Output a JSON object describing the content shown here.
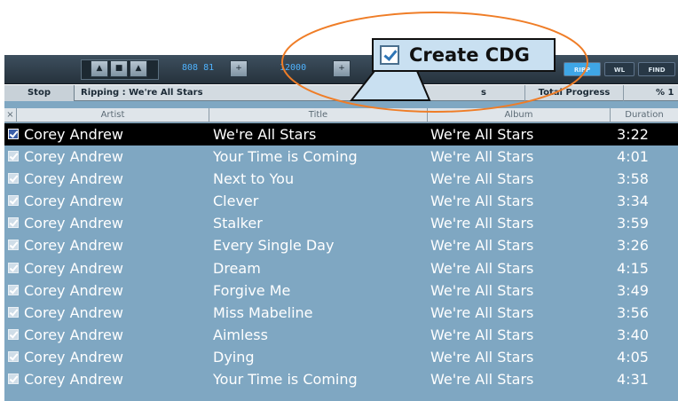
{
  "toolbar": {
    "lcd_left": "808 81",
    "lcd_right": "12000",
    "rip_button": "RIPP",
    "wl_button": "WL",
    "find_button": "FIND"
  },
  "status": {
    "stop_button": "Stop",
    "ripping_text": "Ripping : We're All Stars",
    "track_fragment": "s",
    "total_progress_label": "Total Progress",
    "percent_label": "% 1"
  },
  "columns": {
    "close": "×",
    "artist": "Artist",
    "title": "Title",
    "album": "Album",
    "duration": "Duration"
  },
  "tracks": [
    {
      "artist": "Corey Andrew",
      "title": "We're All Stars",
      "album": "We're All Stars",
      "duration": "3:22",
      "selected": true
    },
    {
      "artist": "Corey Andrew",
      "title": "Your Time is Coming",
      "album": "We're All Stars",
      "duration": "4:01"
    },
    {
      "artist": "Corey Andrew",
      "title": "Next to You",
      "album": "We're All Stars",
      "duration": "3:58"
    },
    {
      "artist": "Corey Andrew",
      "title": "Clever",
      "album": "We're All Stars",
      "duration": "3:34"
    },
    {
      "artist": "Corey Andrew",
      "title": "Stalker",
      "album": "We're All Stars",
      "duration": "3:59"
    },
    {
      "artist": "Corey Andrew",
      "title": "Every Single Day",
      "album": "We're All Stars",
      "duration": "3:26"
    },
    {
      "artist": "Corey Andrew",
      "title": "Dream",
      "album": "We're All Stars",
      "duration": "4:15"
    },
    {
      "artist": "Corey Andrew",
      "title": "Forgive Me",
      "album": "We're All Stars",
      "duration": "3:49"
    },
    {
      "artist": "Corey Andrew",
      "title": "Miss Mabeline",
      "album": "We're All Stars",
      "duration": "3:56"
    },
    {
      "artist": "Corey Andrew",
      "title": "Aimless",
      "album": "We're All Stars",
      "duration": "3:40"
    },
    {
      "artist": "Corey Andrew",
      "title": "Dying",
      "album": "We're All Stars",
      "duration": "4:05"
    },
    {
      "artist": "Corey Andrew",
      "title": "Your Time is Coming",
      "album": "We're All Stars",
      "duration": "4:31"
    }
  ],
  "callout": {
    "label": "Create CDG",
    "ellipse_color": "#ef7d27"
  }
}
